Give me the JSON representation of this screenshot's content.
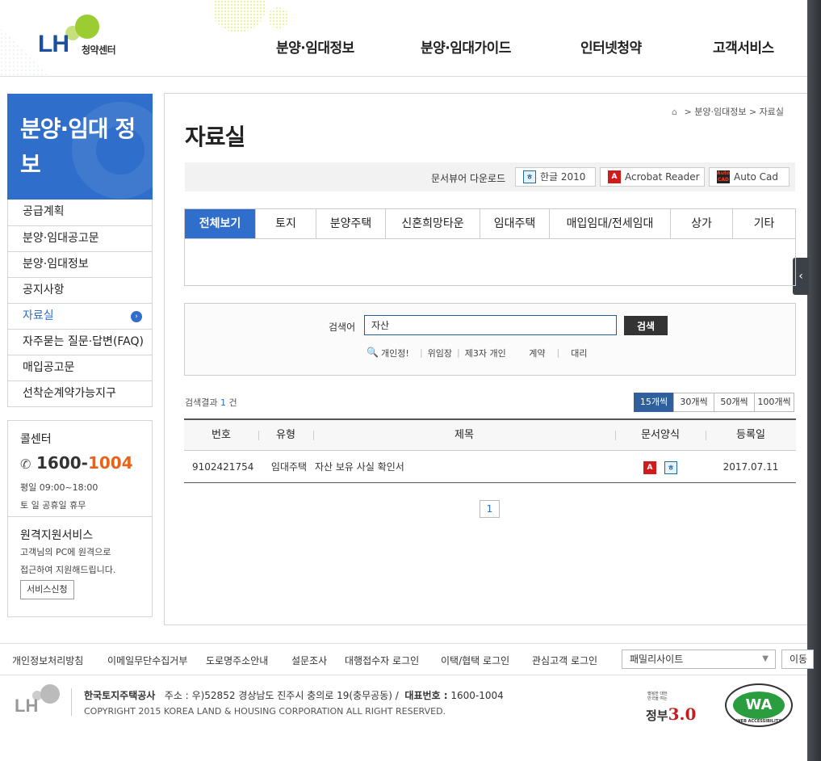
{
  "header": {
    "logo_text": "LH",
    "logo_sub": "청약센터",
    "gnb": [
      "분양·임대정보",
      "분양·임대가이드",
      "인터넷청약",
      "고객서비스"
    ]
  },
  "sidebar": {
    "title": "분양·임대 정보",
    "items": [
      {
        "label": "공급계획",
        "active": false
      },
      {
        "label": "분양·임대공고문",
        "active": false
      },
      {
        "label": "분양·임대정보",
        "active": false
      },
      {
        "label": "공지사항",
        "active": false
      },
      {
        "label": "자료실",
        "active": true
      },
      {
        "label": "자주묻는 질문·답변(FAQ)",
        "active": false
      },
      {
        "label": "매입공고문",
        "active": false
      },
      {
        "label": "선착순계약가능지구",
        "active": false
      }
    ],
    "call_title": "콜센터",
    "call_num_a": "1600-",
    "call_num_b": "1004",
    "call_hours_1": "평일 09:00~18:00",
    "call_hours_2": "토 일 공휴일 휴무",
    "remote_title": "원격지원서비스",
    "remote_desc_1": "고객님의 PC에 원격으로",
    "remote_desc_2": "접근하여 지원해드립니다.",
    "remote_btn": "서비스신청"
  },
  "breadcrumb": {
    "items": [
      "분양·임대정보",
      "자료실"
    ],
    "sep": ">"
  },
  "page_title": "자료실",
  "viewer": {
    "label": "문서뷰어 다운로드",
    "buttons": [
      {
        "label": "한글 2010",
        "icon": "hwp-icon"
      },
      {
        "label": "Acrobat Reader",
        "icon": "pdf-icon"
      },
      {
        "label": "Auto Cad",
        "icon": "autocad-icon"
      }
    ]
  },
  "tabs": [
    {
      "label": "전체보기",
      "active": true
    },
    {
      "label": "토지",
      "active": false
    },
    {
      "label": "분양주택",
      "active": false
    },
    {
      "label": "신혼희망타운",
      "active": false
    },
    {
      "label": "임대주택",
      "active": false
    },
    {
      "label": "매입임대/전세임대",
      "active": false
    },
    {
      "label": "상가",
      "active": false
    },
    {
      "label": "기타",
      "active": false
    }
  ],
  "search": {
    "label": "검색어",
    "value": "자산",
    "button": "검색",
    "keywords": [
      "개인정!",
      "위임장",
      "제3자 개인",
      "계약",
      "대리"
    ]
  },
  "results": {
    "prefix": "검색결과",
    "count": "1",
    "suffix": "건",
    "per_page": [
      {
        "label": "15개씩",
        "active": true
      },
      {
        "label": "30개씩",
        "active": false
      },
      {
        "label": "50개씩",
        "active": false
      },
      {
        "label": "100개씩",
        "active": false
      }
    ]
  },
  "table": {
    "headers": [
      "번호",
      "유형",
      "제목",
      "문서양식",
      "등록일"
    ],
    "rows": [
      {
        "no": "9102421754",
        "type": "임대주택",
        "title": "자산 보유 사실 확인서",
        "formats": [
          "pdf-icon",
          "hwp-icon"
        ],
        "date": "2017.07.11"
      }
    ]
  },
  "pagination": {
    "current": "1"
  },
  "footer": {
    "links": [
      "개인정보처리방침",
      "이메일무단수집거부",
      "도로명주소안내",
      "설문조사",
      "대행접수자 로그인",
      "이택/협택 로그인",
      "관심고객 로그인"
    ],
    "family_site": "패밀리사이트",
    "go_btn": "이동",
    "logo_text": "LH",
    "company": "한국토지주택공사",
    "address_label": "주소 :",
    "address": "우)52852 경상남도 진주시 충의로 19(충무공동)",
    "rep_label": "대표번호 :",
    "rep_num": "1600-1004",
    "copyright": "COPYRIGHT 2015 KOREA LAND & HOUSING CORPORATION ALL RIGHT RESERVED.",
    "gov_small": "행복한 대한민국을 여는",
    "gov_main": "정부",
    "gov_ver": "3.0",
    "wa_mark": "WA",
    "wa_text": "WEB ACCESSIBILITY"
  }
}
